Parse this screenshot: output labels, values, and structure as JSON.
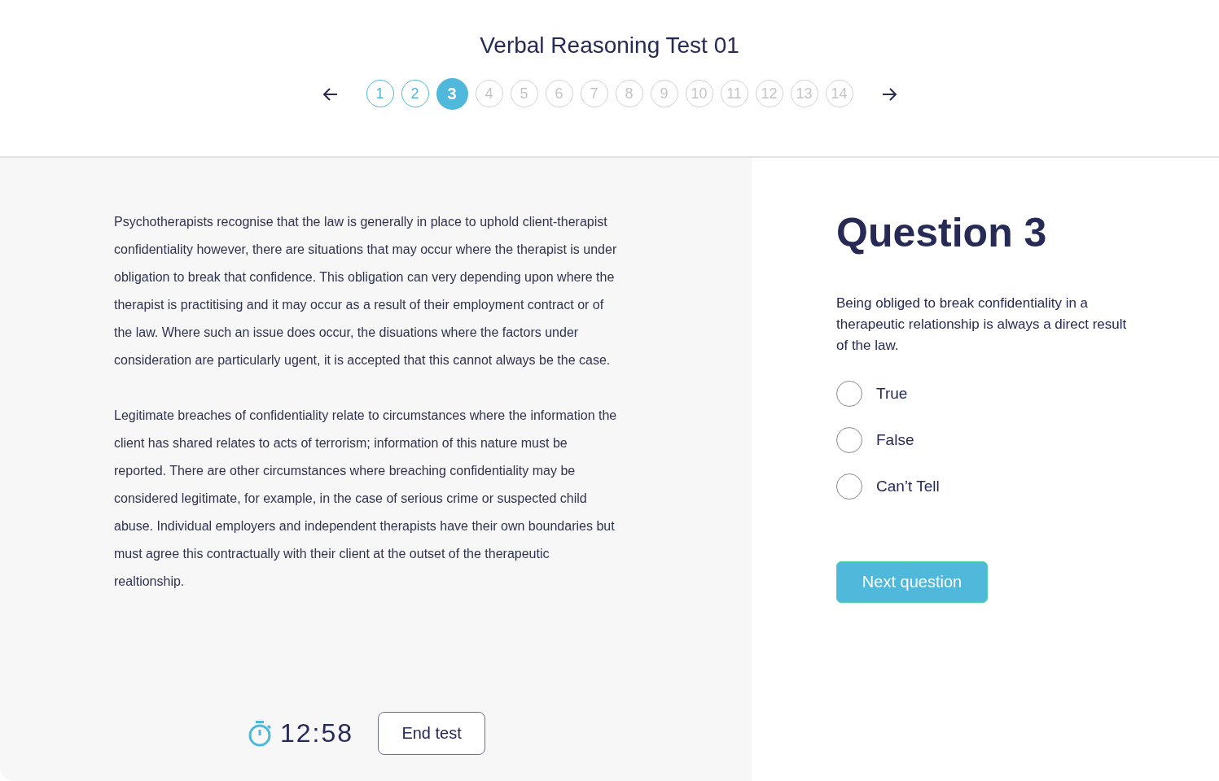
{
  "header": {
    "title": "Verbal Reasoning Test 01"
  },
  "pagination": [
    {
      "label": "1",
      "answered": true,
      "selected": false
    },
    {
      "label": "2",
      "answered": true,
      "selected": false
    },
    {
      "label": "3",
      "answered": false,
      "selected": true
    },
    {
      "label": "4",
      "answered": false,
      "selected": false
    },
    {
      "label": "5",
      "answered": false,
      "selected": false
    },
    {
      "label": "6",
      "answered": false,
      "selected": false
    },
    {
      "label": "7",
      "answered": false,
      "selected": false
    },
    {
      "label": "8",
      "answered": false,
      "selected": false
    },
    {
      "label": "9",
      "answered": false,
      "selected": false
    },
    {
      "label": "10",
      "answered": false,
      "selected": false
    },
    {
      "label": "11",
      "answered": false,
      "selected": false
    },
    {
      "label": "12",
      "answered": false,
      "selected": false
    },
    {
      "label": "13",
      "answered": false,
      "selected": false
    },
    {
      "label": "14",
      "answered": false,
      "selected": false
    }
  ],
  "passage": [
    "Psychotherapists recognise that the law is generally in place to uphold client-therapist confidentiality however, there are situations that may occur where the therapist is under obligation to break that confidence. This obligation can very depending upon where the therapist is practitising and it may occur as a result of their employment contract or of the law. Where such an issue does occur, the disuations where the factors under consideration are particularly ugent, it is accepted that this cannot always be the case.",
    "Legitimate breaches of confidentiality relate to circumstances where the information the client has shared relates to acts of terrorism; information of this nature must be reported. There are other circumstances where breaching confidentiality may be considered legitimate, for example, in the case of serious crime or suspected child abuse. Individual employers and independent therapists have their own boundaries but must agree this contractually with their client at the outset of the therapeutic realtionship."
  ],
  "timer": {
    "time": "12:58"
  },
  "end_button": "End test",
  "question": {
    "title": "Question 3",
    "statement": "Being obliged to break confidentiality in a therapeutic relationship is always a direct result of the law.",
    "options": [
      {
        "label": "True",
        "selected": false
      },
      {
        "label": "False",
        "selected": false
      },
      {
        "label": "Can’t Tell",
        "selected": false
      }
    ]
  },
  "next_button": "Next question"
}
